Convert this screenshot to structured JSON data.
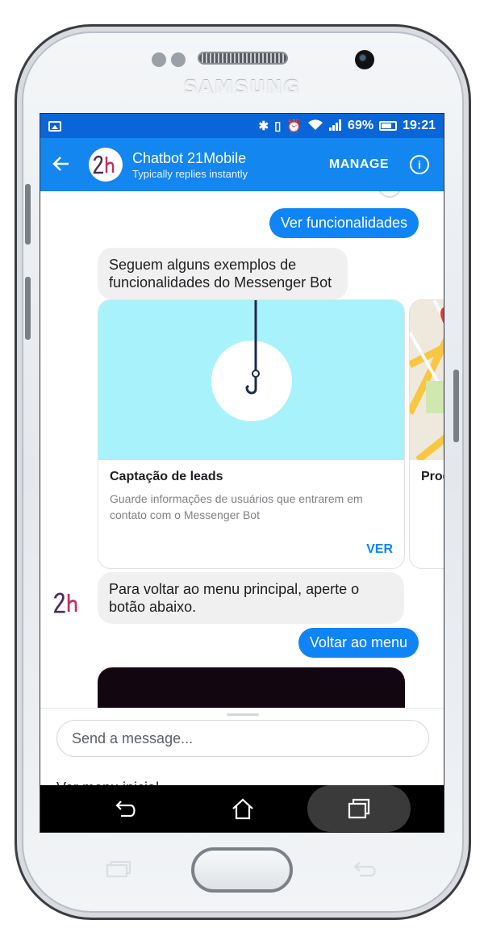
{
  "device": {
    "brand": "SAMSUNG"
  },
  "status_bar": {
    "battery": "69%",
    "time": "19:21",
    "battery_level": 0.69
  },
  "header": {
    "back_icon": "arrow-left-icon",
    "title": "Chatbot 21Mobile",
    "subtitle": "Typically replies instantly",
    "manage_label": "MANAGE",
    "info_icon": "info-circle-icon",
    "brand_color": "#1486f0"
  },
  "messages": {
    "out_1": "Ver funcionalidades",
    "in_1": "Seguem alguns exemplos de funcionalidades do Messenger Bot",
    "card_1": {
      "title": "Captação de leads",
      "description": "Guarde informações de usuários que entrarem em contato com o Messenger Bot",
      "button": "VER"
    },
    "card_2": {
      "title": "Prod"
    },
    "in_2": "Para voltar ao menu principal, aperte o botão abaixo.",
    "out_2": "Voltar ao menu"
  },
  "composer": {
    "placeholder": "Send a message...",
    "quick_reply": "Ver menu inicial"
  },
  "colors": {
    "outgoing_bubble": "#0f84f6",
    "incoming_bubble": "#f1f0f0",
    "status_bar": "#0a66d8"
  }
}
